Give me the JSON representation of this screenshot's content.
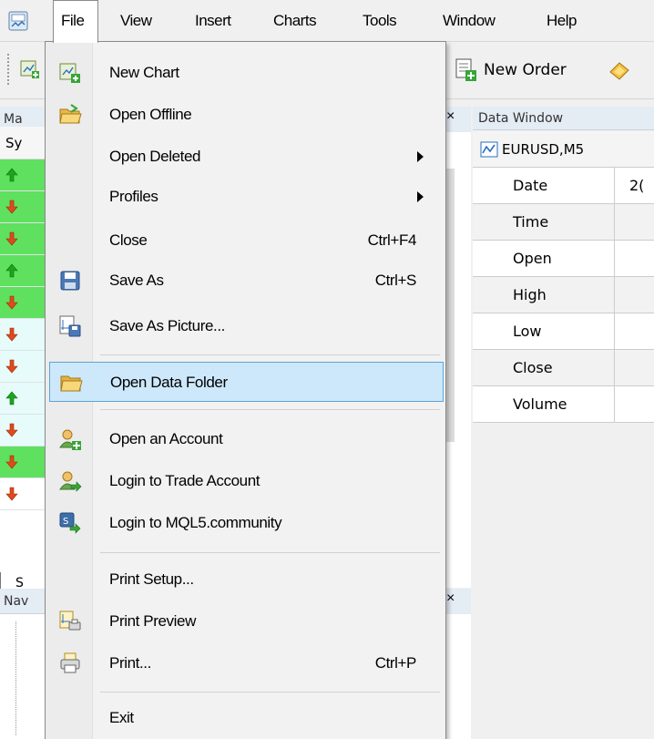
{
  "menubar": {
    "items": [
      {
        "label": "File",
        "active": true
      },
      {
        "label": "View"
      },
      {
        "label": "Insert"
      },
      {
        "label": "Charts"
      },
      {
        "label": "Tools"
      },
      {
        "label": "Window"
      },
      {
        "label": "Help"
      }
    ]
  },
  "toolbar": {
    "new_order_label": "New Order"
  },
  "market_watch": {
    "header": "Ma",
    "column": "Sy",
    "rows": [
      "up",
      "down",
      "down",
      "up",
      "down",
      "down",
      "down",
      "up",
      "down",
      "down",
      "down"
    ],
    "tab": "S"
  },
  "navigator": {
    "header": "Nav"
  },
  "data_window": {
    "header": "Data Window",
    "symbol": "EURUSD,M5",
    "rows": [
      {
        "label": "Date",
        "value": "2("
      },
      {
        "label": "Time",
        "value": ""
      },
      {
        "label": "Open",
        "value": ""
      },
      {
        "label": "High",
        "value": ""
      },
      {
        "label": "Low",
        "value": ""
      },
      {
        "label": "Close",
        "value": ""
      },
      {
        "label": "Volume",
        "value": ""
      }
    ]
  },
  "file_menu": {
    "items": [
      {
        "label": "New Chart",
        "icon": "new-chart-icon",
        "shortcut": ""
      },
      {
        "label": "Open Offline",
        "icon": "open-folder-icon",
        "shortcut": ""
      },
      {
        "label": "Open Deleted",
        "icon": "",
        "shortcut": "",
        "submenu": true
      },
      {
        "label": "Profiles",
        "icon": "",
        "shortcut": "",
        "submenu": true
      },
      {
        "label": "Close",
        "icon": "",
        "shortcut": "Ctrl+F4"
      },
      {
        "label": "Save As",
        "icon": "floppy-disk-icon",
        "shortcut": "Ctrl+S"
      },
      {
        "label": "Save As Picture...",
        "icon": "save-picture-icon",
        "shortcut": ""
      },
      {
        "label": "Open Data Folder",
        "icon": "folder-icon",
        "shortcut": "",
        "highlighted": true
      },
      {
        "label": "Open an Account",
        "icon": "add-user-icon",
        "shortcut": ""
      },
      {
        "label": "Login to Trade Account",
        "icon": "login-user-icon",
        "shortcut": ""
      },
      {
        "label": "Login to MQL5.community",
        "icon": "mql5-icon",
        "shortcut": ""
      },
      {
        "label": "Print Setup...",
        "icon": "",
        "shortcut": ""
      },
      {
        "label": "Print Preview",
        "icon": "print-preview-icon",
        "shortcut": ""
      },
      {
        "label": "Print...",
        "icon": "printer-icon",
        "shortcut": "Ctrl+P"
      },
      {
        "label": "Exit",
        "icon": "",
        "shortcut": ""
      }
    ]
  },
  "colors": {
    "highlight_bg": "#cde8fb",
    "highlight_border": "#5ea2d6",
    "row_green": "#5fe05f",
    "arrow_up": "#1ea51e",
    "arrow_down": "#e04a1a"
  }
}
